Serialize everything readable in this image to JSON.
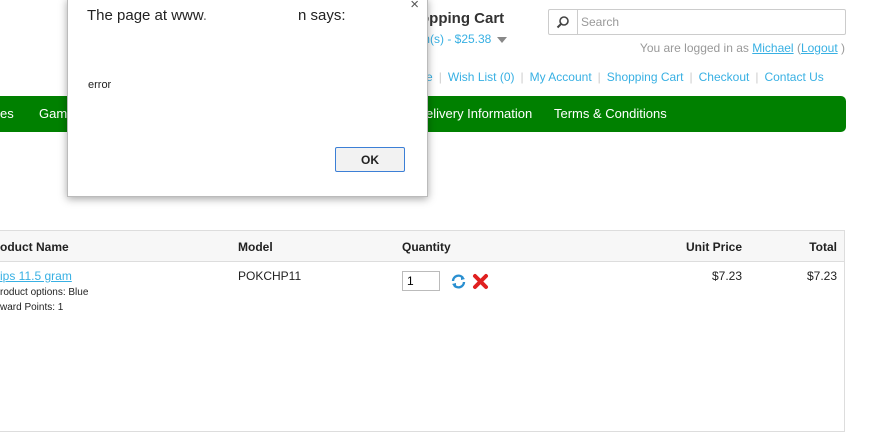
{
  "header": {
    "cart_title": "opping Cart",
    "cart_summary": "m(s) - $25.38",
    "search_placeholder": "Search",
    "logged_prefix": "You are logged in as",
    "user_name": "Michael",
    "paren_open": "(",
    "logout": "Logout",
    "paren_close": ")"
  },
  "toplinks": [
    {
      "label": "e"
    },
    {
      "label": "Wish List (0)"
    },
    {
      "label": "My Account"
    },
    {
      "label": "Shopping Cart"
    },
    {
      "label": "Checkout"
    },
    {
      "label": "Contact Us"
    }
  ],
  "menu": {
    "items": [
      "es",
      "Gam",
      "elivery Information",
      "Terms & Conditions"
    ]
  },
  "table": {
    "headers": [
      "oduct Name",
      "Model",
      "Quantity",
      "Unit Price",
      "Total"
    ],
    "row": {
      "name": "ips 11.5 gram",
      "option1": "roduct options: Blue",
      "option2": "ward Points: 1",
      "model": "POKCHP11",
      "quantity": "1",
      "unit_price": "$7.23",
      "total": "$7.23"
    }
  },
  "dialog": {
    "title_prefix": "The page at www.",
    "title_suffix": "n says:",
    "close": "×",
    "message": "error",
    "ok": "OK"
  },
  "colors": {
    "menu_green": "#008000",
    "link": "#38b0e3",
    "remove_red": "#e02020",
    "update_blue": "#2a8fd0"
  }
}
